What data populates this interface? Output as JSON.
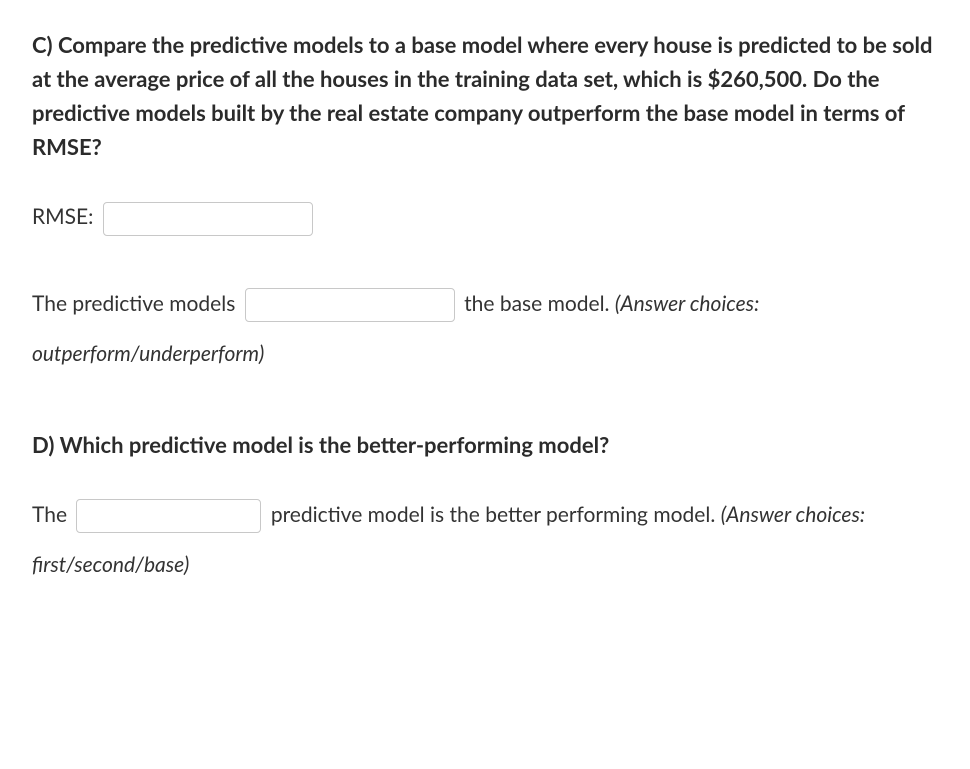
{
  "questionC": {
    "heading": "C) Compare the predictive models to a base model where every house is predicted to be sold at the average price of all the houses in the training data set, which is $260,500. Do the predictive models built by the real estate company outperform the base model in terms of RMSE?",
    "rmse_label": "RMSE:",
    "rmse_value": "",
    "sentence_part1": "The predictive models",
    "input_value": "",
    "sentence_part2": "the base model. ",
    "hint_label": "(Answer choices: outperform/underperform)"
  },
  "questionD": {
    "heading": "D) Which predictive model is the better-performing model?",
    "sentence_part1": "The",
    "input_value": "",
    "sentence_part2": "predictive model is the better performing model. ",
    "hint_label": "(Answer choices: first/second/base)"
  }
}
